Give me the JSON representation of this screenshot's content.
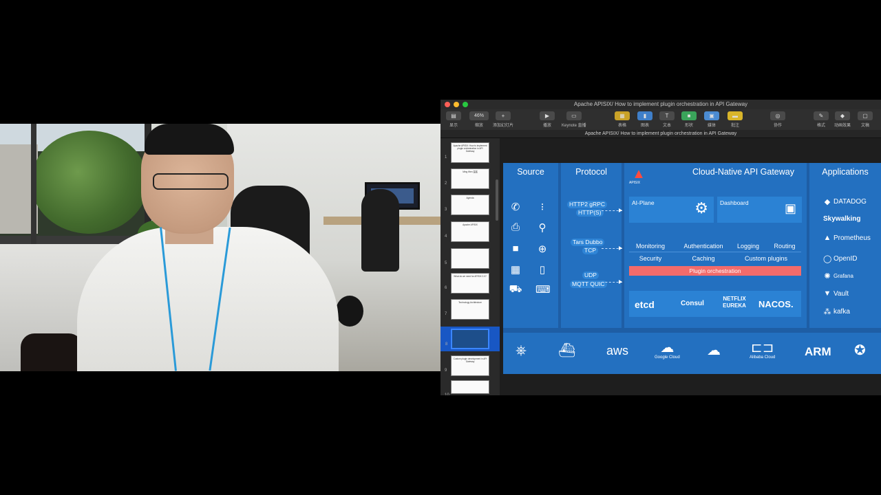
{
  "window": {
    "title": "Apache APISIX/ How to implement plugin orchestration in API Gateway",
    "doc_title": "Apache APISIX/ How to implement plugin orchestration in API Gateway",
    "zoom": "46%"
  },
  "toolbar": {
    "view": "显示",
    "zoom_label": "缩放",
    "add_slide": "添加幻灯片",
    "play": "播放",
    "keynote_live": "Keynote 直播",
    "table": "表格",
    "chart": "图表",
    "text": "文本",
    "shape": "形状",
    "media": "媒体",
    "comment": "批注",
    "collaborate": "协作",
    "format": "格式",
    "animate": "动画效果",
    "document": "文稿"
  },
  "navigator": {
    "slides": [
      {
        "num": "1",
        "text": "Apache APISIX: How to implement plugin orchestration in API Gateway"
      },
      {
        "num": "2",
        "text": "Ming Wen 温铭"
      },
      {
        "num": "3",
        "text": "Agenda"
      },
      {
        "num": "4",
        "text": "Apache APISIX"
      },
      {
        "num": "5",
        "text": ""
      },
      {
        "num": "6",
        "text": "What do we need for APISIX 2.0?"
      },
      {
        "num": "7",
        "text": "Technology Architecture"
      },
      {
        "num": "8",
        "text": ""
      },
      {
        "num": "9",
        "text": "Custom plugin development in API Gateway"
      },
      {
        "num": "10",
        "text": ""
      }
    ]
  },
  "slide": {
    "source": {
      "title": "Source",
      "icons": [
        "phone-icon",
        "traffic-light-icon",
        "printer-icon",
        "antenna-icon",
        "camera-icon",
        "globe-icon",
        "building-icon",
        "mobile-icon",
        "truck-icon",
        "laptop-icon"
      ]
    },
    "protocol": {
      "title": "Protocol",
      "groups": [
        {
          "line1": "HTTP2   gRPC",
          "line2": "HTTP(S)"
        },
        {
          "line1": "Tars   Dubbo",
          "line2": "TCP"
        },
        {
          "line1": "UDP",
          "line2": "MQTT  QUIC"
        }
      ]
    },
    "gateway": {
      "title": "Cloud-Native API Gateway",
      "logo": "APISIX",
      "ai_plane": "AI-Plane",
      "dashboard": "Dashboard",
      "features_row1": [
        "Monitoring",
        "Authentication",
        "Logging",
        "Routing"
      ],
      "features_row2": [
        "Security",
        "Caching",
        "Custom plugins"
      ],
      "orchestration": "Plugin orchestration",
      "stores": [
        "etcd",
        "Consul",
        "NETFLIX EUREKA",
        "NACOS."
      ]
    },
    "applications": {
      "title": "Applications",
      "items": [
        "DATADOG",
        "Skywalking",
        "Prometheus",
        "OpenID",
        "Grafana",
        "Vault",
        "kafka"
      ]
    },
    "platforms": {
      "google_cloud": "Google Cloud",
      "aws": "aws",
      "alibaba": "Alibaba Cloud",
      "arm": "ARM"
    }
  },
  "colors": {
    "slide_bg": "#1e5ea5",
    "panel": "#2370c0",
    "accent_red": "#f26b6b",
    "selection": "#1857c4"
  }
}
